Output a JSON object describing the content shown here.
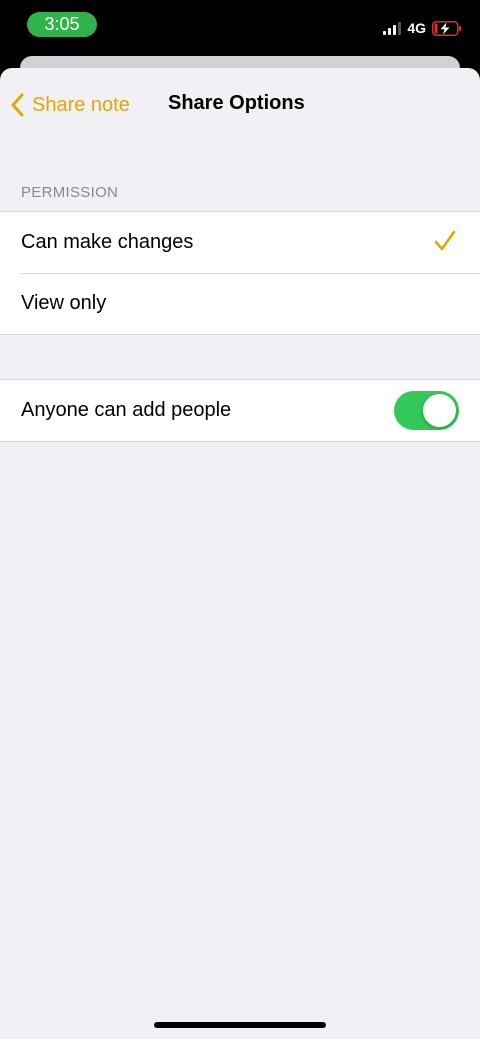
{
  "status_bar": {
    "time": "3:05",
    "network": "4G",
    "icons": [
      "signal-icon",
      "battery-charging-icon"
    ]
  },
  "nav": {
    "back_label": "Share note",
    "title": "Share Options",
    "back_icon": "chevron-left-icon"
  },
  "permission": {
    "header": "PERMISSION",
    "options": [
      {
        "label": "Can make changes",
        "selected": true
      },
      {
        "label": "View only",
        "selected": false
      }
    ]
  },
  "settings": {
    "anyone_can_add_label": "Anyone can add people",
    "anyone_can_add_on": true
  },
  "colors": {
    "accent": "#e3a800",
    "toggle_on": "#34c759",
    "time_pill": "#2fb34a",
    "background": "#f0f0f5",
    "battery_low": "#e0302a"
  }
}
